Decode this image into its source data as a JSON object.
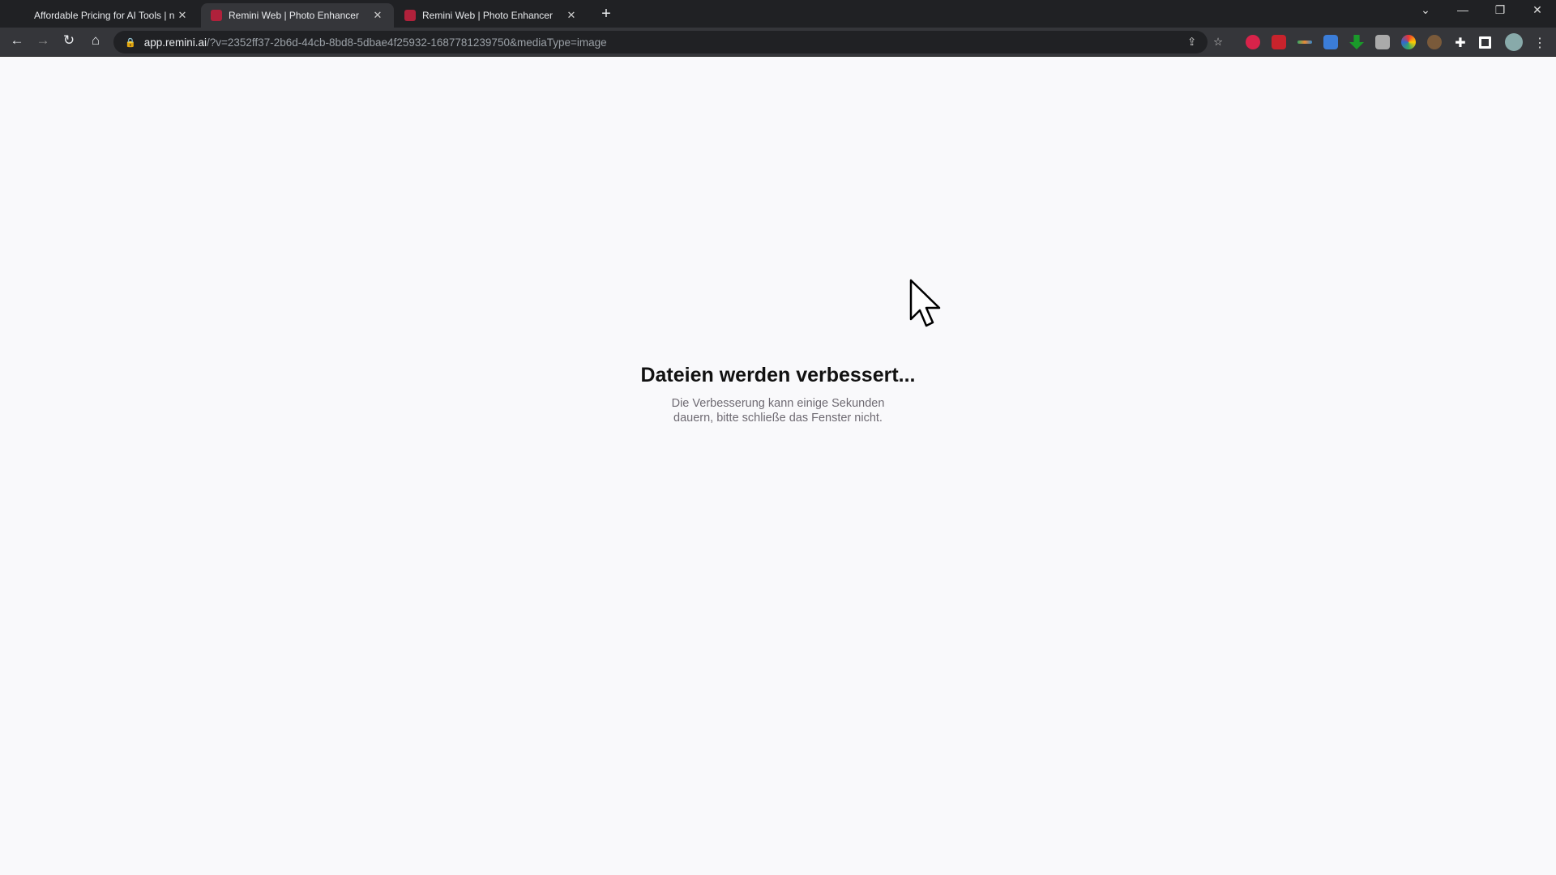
{
  "browser": {
    "tabs": [
      {
        "title": "Affordable Pricing for AI Tools | n",
        "active": false
      },
      {
        "title": "Remini Web | Photo Enhancer",
        "active": true
      },
      {
        "title": "Remini Web | Photo Enhancer",
        "active": false
      }
    ],
    "url_host": "app.remini.ai",
    "url_path": "/?v=2352ff37-2b6d-44cb-8bd8-5dbae4f25932-1687781239750&mediaType=image",
    "extensions": [
      "abp-icon",
      "save-icon",
      "rainbow-icon",
      "bitwarden-icon",
      "download-icon",
      "camera-icon",
      "color-icon",
      "cookie-icon",
      "puzzle-icon",
      "sidepanel-icon",
      "avatar-icon",
      "menu-icon"
    ],
    "accent": "#b0213b"
  },
  "page": {
    "title": "Dateien werden verbessert...",
    "subtitle_line1": "Die Verbesserung kann einige Sekunden",
    "subtitle_line2": "dauern, bitte schließe das Fenster nicht."
  }
}
